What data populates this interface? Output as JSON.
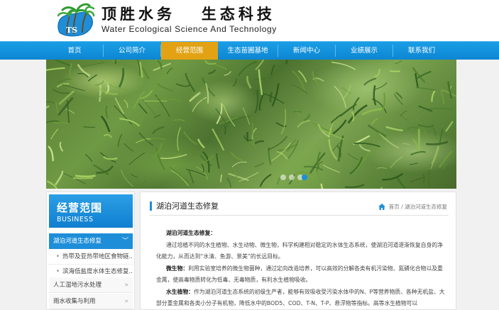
{
  "header": {
    "cn_title": "顶胜水务   生态科技",
    "en_title": "Water Ecological Science And Technology",
    "logo_text": "TS"
  },
  "nav": {
    "items": [
      {
        "label": "首页"
      },
      {
        "label": "公司简介"
      },
      {
        "label": "经营范围",
        "active": true
      },
      {
        "label": "生态苗圃基地"
      },
      {
        "label": "新闻中心"
      },
      {
        "label": "业绩展示"
      },
      {
        "label": "联系我们"
      }
    ]
  },
  "banner": {
    "slides": 4,
    "active_slide": 3
  },
  "sidebar": {
    "title_cn": "经营范围",
    "title_en": "BUSINESS",
    "items": [
      {
        "label": "湖泊河道生态修复",
        "active": true
      },
      {
        "label": "热带及亚热带地区食物链..."
      },
      {
        "label": "滨海低盐度水体生态修复..."
      },
      {
        "label": "人工湿地污水处理"
      },
      {
        "label": "雨水收集与利用"
      }
    ]
  },
  "content": {
    "title": "湖泊河道生态修复",
    "breadcrumb": {
      "home": "首页",
      "sep": " / ",
      "current": "湖泊河道生态修复"
    },
    "heading": "湖泊河道生态修复：",
    "para1": "通过培植不同的水生植物、水生动物、微生物，科学构建相对稳定的水体生态系统，使湖泊河道逐渐恢复自身的净化能力，从而达到“水清、鱼游、景美”的长远目标。",
    "para2_label": "微生物：",
    "para2": "利用实验室培养的微生物菌种，通过定向改造培养，可以高效的分解各类有机污染物、氮磷化合物以及重金属，使高毒物质转化为低毒、无毒物质，有利水生植物吸收。",
    "para3_label": "水生植物：",
    "para3": "作为湖泊河道生态系统的初级生产者，能够有效吸收受污染水体中的N、P等营养物质、各种无机盐、大部分重金属和各类小分子有机物，降低水中的BOD5、COD、T-N、T-P、悬浮物等指标。高等水生植物可以"
  },
  "colors": {
    "nav_blue": "#0d86d2",
    "nav_active": "#e2a214",
    "sidebar_active": "#1e8ed8"
  }
}
